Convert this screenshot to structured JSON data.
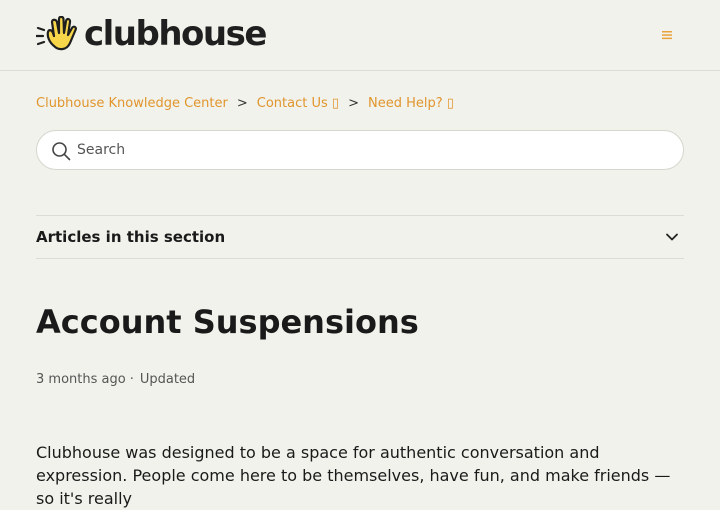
{
  "header": {
    "logo_text": "clubhouse",
    "menu_icon": "menu-icon"
  },
  "breadcrumb": [
    {
      "label": "Clubhouse Knowledge Center"
    },
    {
      "label": "Contact Us ▯"
    },
    {
      "label": "Need Help? ▯"
    }
  ],
  "breadcrumb_separator": ">",
  "search": {
    "placeholder": "Search",
    "value": ""
  },
  "section_toggle": {
    "label": "Articles in this section"
  },
  "article": {
    "title": "Account Suspensions",
    "relative_time": "3 months ago",
    "meta_separator": "·",
    "status": "Updated",
    "body": "Clubhouse was designed to be a space for authentic conversation and expression. People come here to be themselves, have fun, and make friends — so it's really"
  },
  "colors": {
    "accent": "#e0952d",
    "background": "#f2f2ec",
    "logo_hand": "#f7d64a"
  }
}
